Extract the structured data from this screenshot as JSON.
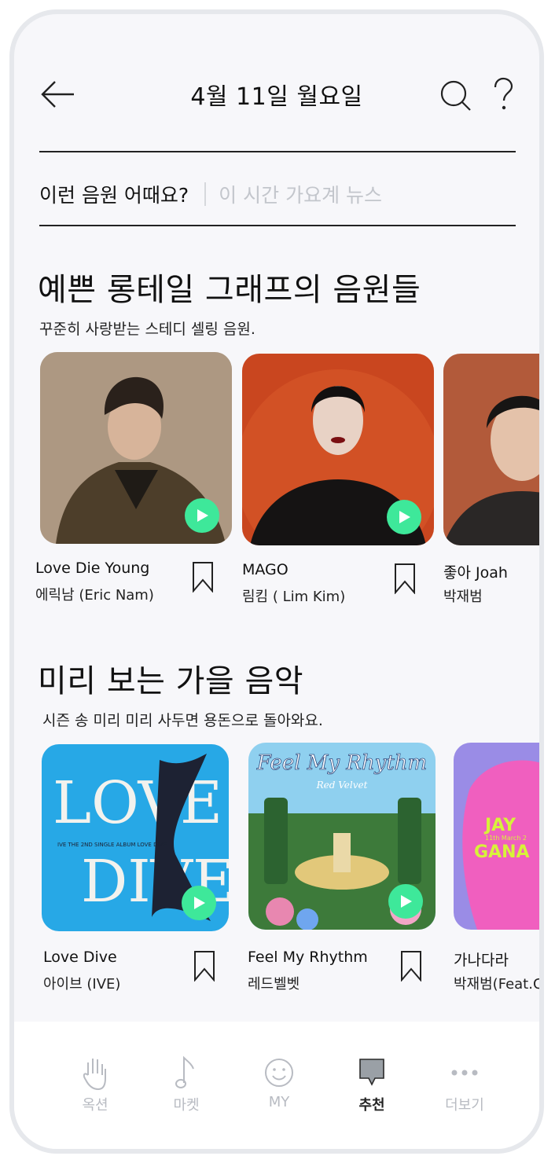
{
  "header": {
    "title": "4월 11일 월요일"
  },
  "tabs": [
    {
      "label": "이런 음원 어때요?",
      "active": true
    },
    {
      "label": "이 시간 가요계 뉴스",
      "active": false
    }
  ],
  "sections": [
    {
      "title": "예쁜 롱테일 그래프의 음원들",
      "subtitle": "꾸준히 사랑받는 스테디 셀링 음원.",
      "items": [
        {
          "title": "Love Die Young",
          "artist": "에릭남 (Eric Nam)"
        },
        {
          "title": "MAGO",
          "artist": "림킴 ( Lim Kim)"
        },
        {
          "title": "좋아 Joah",
          "artist": "박재범"
        }
      ]
    },
    {
      "title": "미리 보는 가을 음악",
      "subtitle": "시즌 송 미리 미리 사두면 용돈으로 돌아와요.",
      "items": [
        {
          "title": "Love Dive",
          "artist": "아이브 (IVE)"
        },
        {
          "title": "Feel My Rhythm",
          "artist": "레드벨벳"
        },
        {
          "title": "가나다라",
          "artist": "박재범(Feat.C"
        }
      ]
    }
  ],
  "cover_art": {
    "love_dive_top": "LOVE",
    "love_dive_bottom": "DIVE",
    "love_dive_small": "IVE THE 2ND SINGLE ALBUM LOVE DIVE",
    "feel_my_rhythm_title": "Feel My Rhythm",
    "feel_my_rhythm_sub": "Red Velvet",
    "ganadara_top": "JAY",
    "ganadara_mid": "11th March 2",
    "ganadara_bottom": "GANA"
  },
  "bottom_nav": [
    {
      "label": "옥션",
      "icon": "hand-icon",
      "active": false
    },
    {
      "label": "마켓",
      "icon": "music-note-icon",
      "active": false
    },
    {
      "label": "MY",
      "icon": "smiley-icon",
      "active": false
    },
    {
      "label": "추천",
      "icon": "speech-bubble-icon",
      "active": true
    },
    {
      "label": "더보기",
      "icon": "more-dots-icon",
      "active": false
    }
  ],
  "colors": {
    "background": "#f7f7fa",
    "play_button": "#3ee89a",
    "inactive_text": "#c3c6cc",
    "love_dive_cover": "#27a8e6",
    "nav_active_icon": "#9aa0a6"
  }
}
